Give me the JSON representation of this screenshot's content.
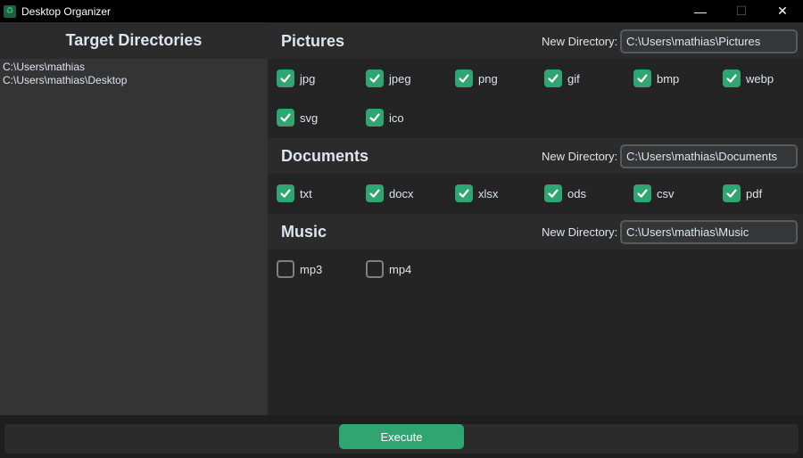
{
  "window": {
    "title": "Desktop Organizer",
    "minimize": "—",
    "maximize": "☐",
    "close": "✕"
  },
  "left_panel": {
    "header": "Target Directories",
    "directories": [
      "C:\\Users\\mathias",
      "C:\\Users\\mathias\\Desktop"
    ]
  },
  "new_directory_label": "New Directory:",
  "sections": [
    {
      "title": "Pictures",
      "directory": "C:\\Users\\mathias\\Pictures",
      "extensions": [
        {
          "label": "jpg",
          "checked": true
        },
        {
          "label": "jpeg",
          "checked": true
        },
        {
          "label": "png",
          "checked": true
        },
        {
          "label": "gif",
          "checked": true
        },
        {
          "label": "bmp",
          "checked": true
        },
        {
          "label": "webp",
          "checked": true
        },
        {
          "label": "svg",
          "checked": true
        },
        {
          "label": "ico",
          "checked": true
        }
      ]
    },
    {
      "title": "Documents",
      "directory": "C:\\Users\\mathias\\Documents",
      "extensions": [
        {
          "label": "txt",
          "checked": true
        },
        {
          "label": "docx",
          "checked": true
        },
        {
          "label": "xlsx",
          "checked": true
        },
        {
          "label": "ods",
          "checked": true
        },
        {
          "label": "csv",
          "checked": true
        },
        {
          "label": "pdf",
          "checked": true
        }
      ]
    },
    {
      "title": "Music",
      "directory": "C:\\Users\\mathias\\Music",
      "extensions": [
        {
          "label": "mp3",
          "checked": false
        },
        {
          "label": "mp4",
          "checked": false
        }
      ]
    }
  ],
  "execute_label": "Execute",
  "colors": {
    "accent": "#2fa572",
    "panel": "#2b2b2b",
    "background": "#242424"
  },
  "icons": {
    "app": "recycle-icon",
    "check": "checkmark-icon"
  }
}
